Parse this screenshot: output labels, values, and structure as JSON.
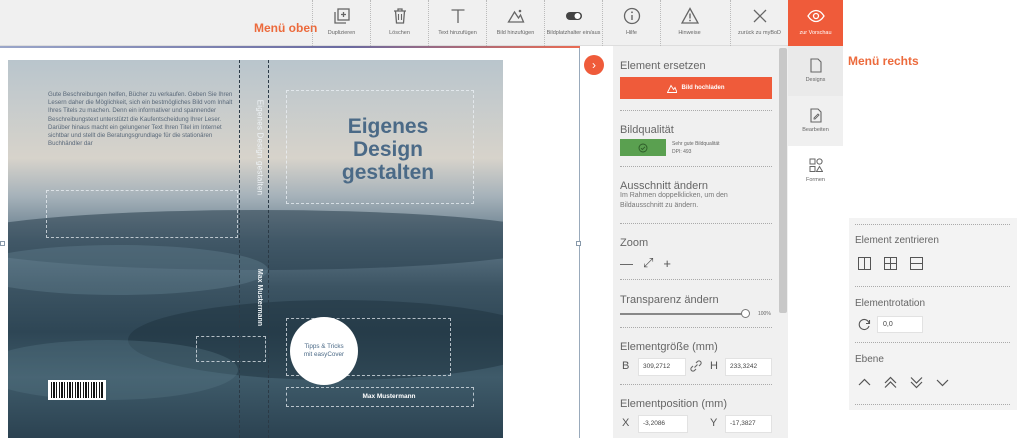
{
  "annotations": {
    "top_menu": "Menü oben",
    "right_menu": "Menü rechts"
  },
  "toolbar": {
    "items": [
      {
        "icon": "duplicate-icon",
        "label": "Duplizieren"
      },
      {
        "icon": "trash-icon",
        "label": "Löschen"
      },
      {
        "icon": "text-icon",
        "label": "Text hinzufügen"
      },
      {
        "icon": "image-icon",
        "label": "Bild hinzufügen"
      },
      {
        "icon": "toggle-icon",
        "label": "Bildplatzhalter ein/aus"
      },
      {
        "icon": "info-icon",
        "label": "Hilfe"
      },
      {
        "icon": "warning-icon",
        "label": "Hinweise"
      },
      {
        "icon": "close-icon",
        "label": "zurück zu myBoD"
      },
      {
        "icon": "eye-icon",
        "label": "zur Vorschau"
      }
    ]
  },
  "cover": {
    "back_text": "Gute Beschreibungen helfen, Bücher zu verkaufen. Geben Sie Ihren Lesern daher die Möglichkeit, sich ein bestmögliches Bild vom Inhalt Ihres Titels zu machen. Denn ein informativer und spannender Beschreibungstext unterstützt die Kaufentscheidung Ihrer Leser. Darüber hinaus macht ein gelungener Text Ihren Titel im Internet sichtbar und stellt die Beratungsgrundlage für die stationären Buchhändler dar",
    "spine_title": "Eigenes Design gestalten",
    "spine_author": "Max Mustermann",
    "title_line1": "Eigenes",
    "title_line2": "Design",
    "title_line3": "gestalten",
    "badge_line1": "Tipps & Tricks",
    "badge_line2": "mit easyCover",
    "author": "Max Mustermann"
  },
  "panel": {
    "replace_title": "Element ersetzen",
    "upload_label": "Bild hochladen",
    "quality_title": "Bildqualität",
    "quality_line1": "Sehr gute Bildqualität",
    "quality_line2": "DPI: 493",
    "crop_title": "Ausschnitt ändern",
    "crop_desc": "Im Rahmen doppelklicken, um den Bildausschnitt zu ändern.",
    "zoom_title": "Zoom",
    "zoom_out": "—",
    "zoom_fit": "⤢",
    "zoom_in": "+",
    "transparency_title": "Transparenz ändern",
    "transparency_value": "100%",
    "transparency_level": 1.0,
    "size_title": "Elementgröße (mm)",
    "width_label": "B",
    "width_value": "309,2712",
    "height_label": "H",
    "height_value": "233,3242",
    "position_title": "Elementposition (mm)",
    "x_label": "X",
    "x_value": "-3,2086",
    "y_label": "Y",
    "y_value": "-17,3827"
  },
  "tabs": [
    {
      "icon": "document-icon",
      "label": "Designs"
    },
    {
      "icon": "edit-icon",
      "label": "Bearbeiten"
    },
    {
      "icon": "shapes-icon",
      "label": "Formen"
    }
  ],
  "detail": {
    "center_title": "Element zentrieren",
    "rotation_title": "Elementrotation",
    "rotation_value": "0,0",
    "layer_title": "Ebene"
  }
}
